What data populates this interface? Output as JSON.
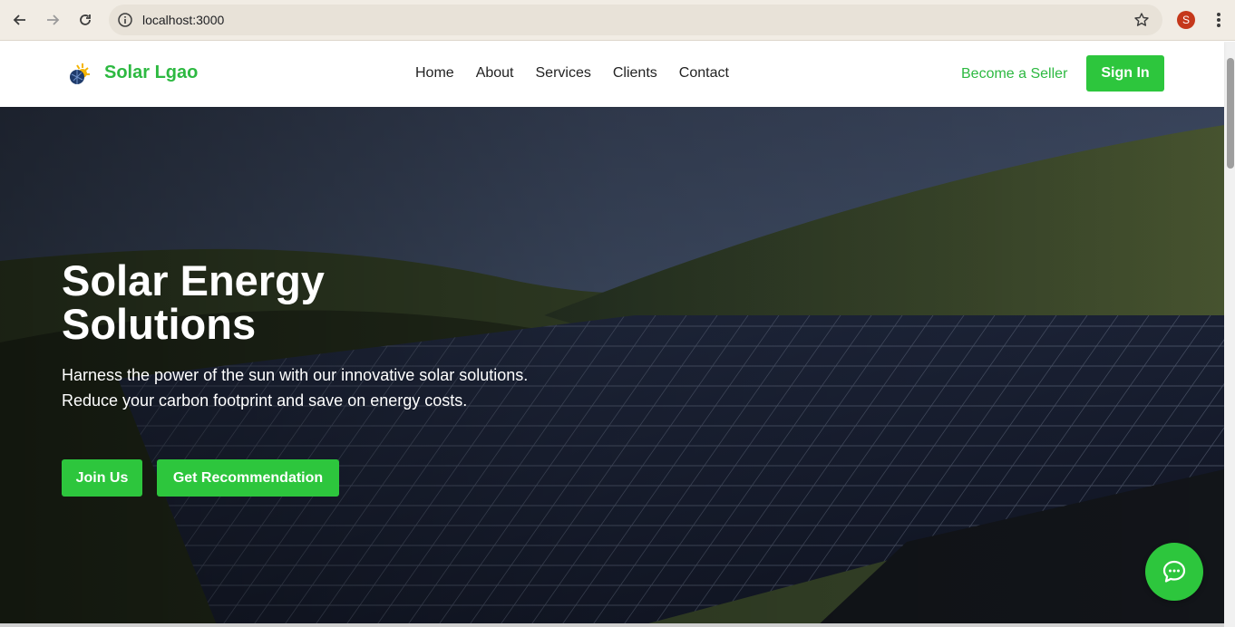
{
  "browser": {
    "url": "localhost:3000",
    "profile_initial": "S",
    "icons": {
      "back": "arrow-left-icon",
      "forward": "arrow-right-icon",
      "reload": "reload-icon",
      "site_info": "info-icon",
      "bookmark": "star-icon",
      "menu": "kebab-icon"
    }
  },
  "header": {
    "brand": "Solar Lgao",
    "menu": [
      "Home",
      "About",
      "Services",
      "Clients",
      "Contact"
    ],
    "seller_link": "Become a Seller",
    "sign_in": "Sign In"
  },
  "hero": {
    "title": "Solar Energy Solutions",
    "text": "Harness the power of the sun with our innovative solar solutions. Reduce your carbon footprint and save on energy costs.",
    "join_button": "Join Us",
    "recommend_button": "Get Recommendation"
  },
  "colors": {
    "brand_green": "#2db941",
    "button_green": "#2dc63d"
  }
}
